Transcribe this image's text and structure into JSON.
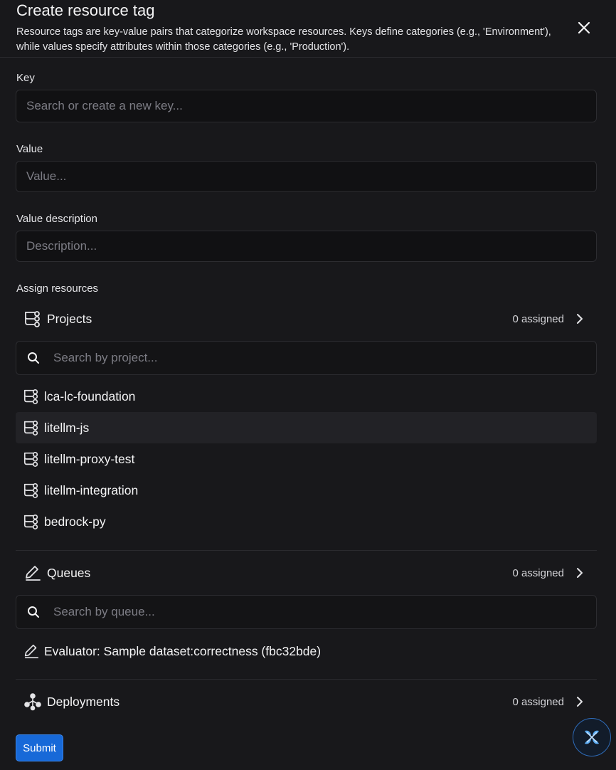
{
  "dialog": {
    "title": "Create resource tag",
    "description": "Resource tags are key-value pairs that categorize workspace resources. Keys define categories (e.g., 'Environment'), while values specify attributes within those categories (e.g., 'Production')."
  },
  "fields": {
    "key": {
      "label": "Key",
      "placeholder": "Search or create a new key..."
    },
    "value": {
      "label": "Value",
      "placeholder": "Value..."
    },
    "description": {
      "label": "Value description",
      "placeholder": "Description..."
    }
  },
  "assign": {
    "heading": "Assign resources",
    "projects": {
      "label": "Projects",
      "assigned": "0 assigned",
      "icon": "project-branch-icon",
      "search_placeholder": "Search by project...",
      "items": [
        {
          "label": "lca-lc-foundation"
        },
        {
          "label": "litellm-js"
        },
        {
          "label": "litellm-proxy-test"
        },
        {
          "label": "litellm-integration"
        },
        {
          "label": "bedrock-py"
        }
      ]
    },
    "queues": {
      "label": "Queues",
      "assigned": "0 assigned",
      "icon": "pen-icon",
      "search_placeholder": "Search by queue...",
      "items": [
        {
          "label": "Evaluator: Sample dataset:correctness (fbc32bde)"
        }
      ]
    },
    "deployments": {
      "label": "Deployments",
      "assigned": "0 assigned",
      "icon": "deployment-nodes-icon"
    }
  },
  "actions": {
    "submit": "Submit"
  },
  "colors": {
    "accent": "#1769d8",
    "background": "#18181b",
    "input_bg": "#111113"
  }
}
